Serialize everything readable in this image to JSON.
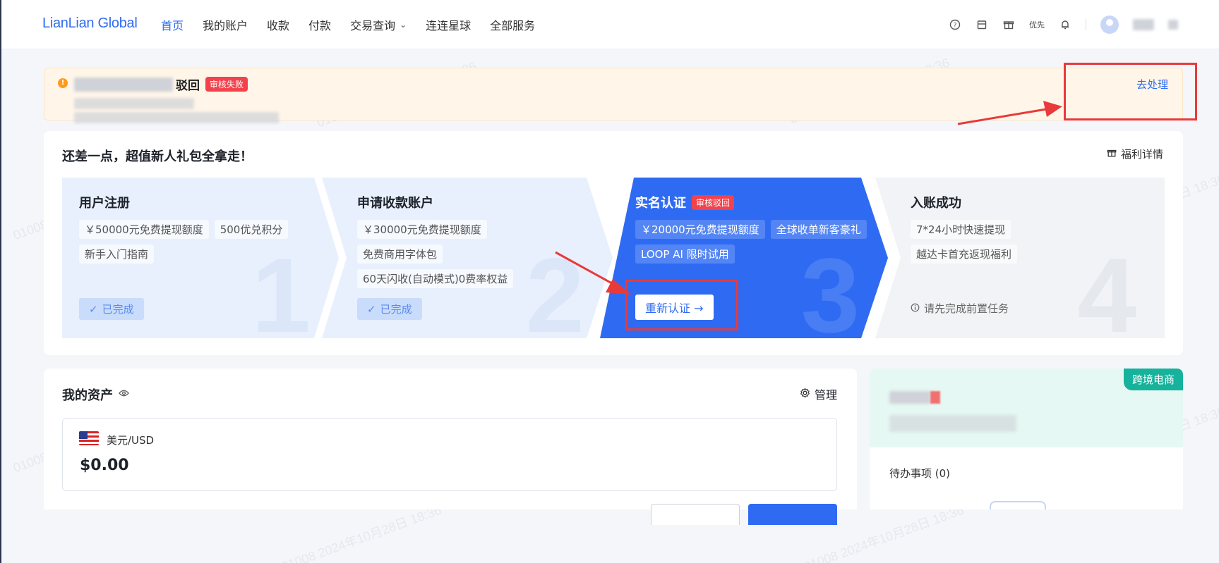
{
  "app": {
    "logo_text": "LianLian Global"
  },
  "nav": {
    "items": [
      {
        "label": "首页",
        "active": true
      },
      {
        "label": "我的账户"
      },
      {
        "label": "收款"
      },
      {
        "label": "付款"
      },
      {
        "label": "交易查询",
        "has_dropdown": true
      },
      {
        "label": "连连星球"
      },
      {
        "label": "全部服务"
      }
    ],
    "right": {
      "help_icon": "question-circle-icon",
      "calendar_icon": "calendar-icon",
      "gift_icon": "gift-icon",
      "coupon_text": "优先",
      "bell_icon": "bell-icon"
    }
  },
  "alert": {
    "title_suffix": "驳回",
    "badge": "审核失败",
    "action": "去处理"
  },
  "onboarding": {
    "title": "还差一点，超值新人礼包全拿走！",
    "details_link": "福利详情",
    "steps": [
      {
        "number": "1",
        "title": "用户注册",
        "tags": [
          "￥50000元免费提现额度",
          "500优兑积分",
          "新手入门指南"
        ],
        "status": "已完成"
      },
      {
        "number": "2",
        "title": "申请收款账户",
        "tags": [
          "￥30000元免费提现额度",
          "免费商用字体包",
          "60天闪收(自动模式)0费率权益"
        ],
        "status": "已完成"
      },
      {
        "number": "3",
        "title": "实名认证",
        "badge": "审核驳回",
        "tags": [
          "￥20000元免费提现额度",
          "全球收单新客豪礼",
          "LOOP AI 限时试用"
        ],
        "button": "重新认证 →"
      },
      {
        "number": "4",
        "title": "入账成功",
        "tags": [
          "7*24小时快速提现",
          "越达卡首充返现福利"
        ],
        "note": "请先完成前置任务"
      }
    ]
  },
  "assets": {
    "title": "我的资产",
    "manage": "管理",
    "currency": "美元/USD",
    "amount": "$0.00"
  },
  "side": {
    "tag": "跨境电商",
    "todo": "待办事项 (0)"
  },
  "watermark": "01008 2024年10月28日 18:36",
  "colors": {
    "primary": "#2f6bf2",
    "danger": "#f2424c",
    "teal": "#16b29b",
    "annotation": "#e83a3a"
  }
}
